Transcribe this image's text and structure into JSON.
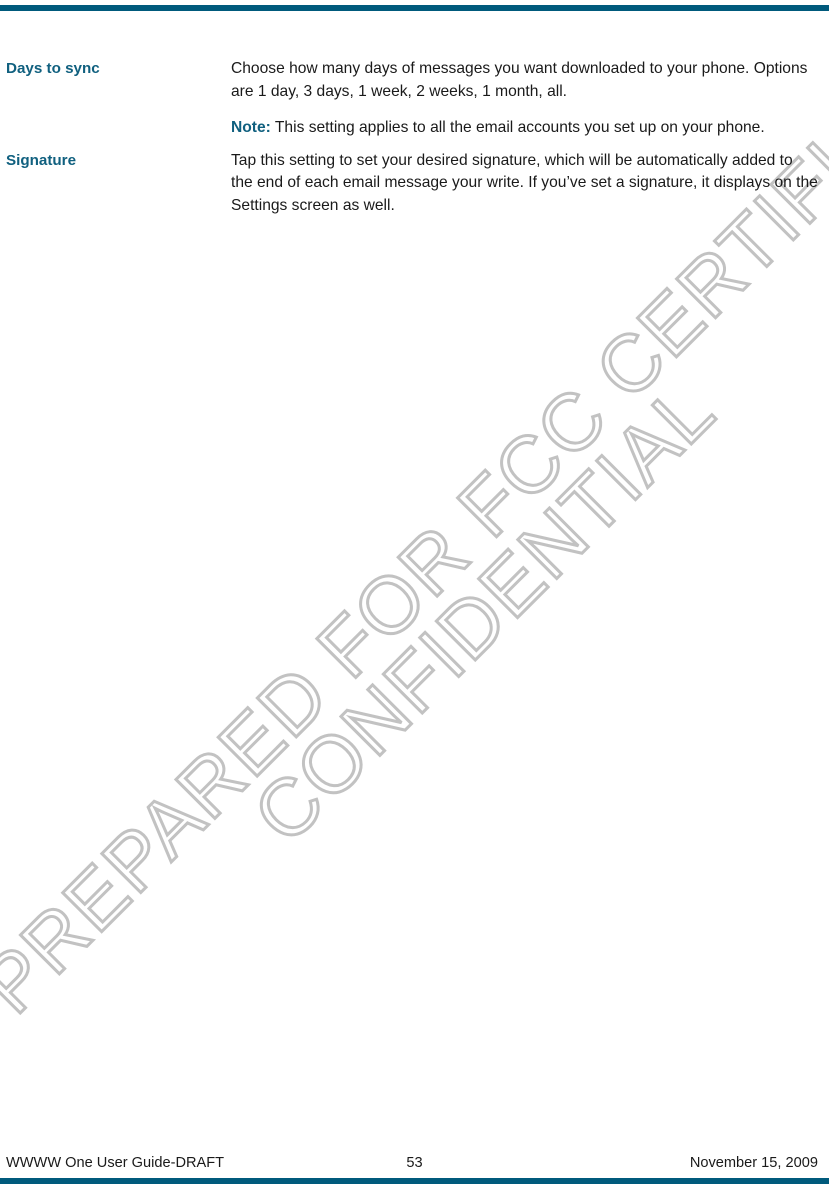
{
  "document": {
    "accent_color": "#005a7c",
    "heading_color": "#10607f",
    "body_color": "#1a1a1a",
    "watermark_color": "#c2c2c2"
  },
  "watermark": {
    "line1": "PREPARED FOR FCC CERTIFICATION",
    "line2": "CONFIDENTIAL"
  },
  "entries": [
    {
      "term": "Days to sync",
      "paragraphs": [
        {
          "label": "",
          "text": "Choose how many days of messages you want downloaded to your phone. Options are 1 day, 3 days, 1 week, 2 weeks, 1 month, all."
        },
        {
          "label": "Note:",
          "text": " This setting applies to all the email accounts you set up on your phone."
        }
      ]
    },
    {
      "term": "Signature",
      "paragraphs": [
        {
          "label": "",
          "text": "Tap this setting to set your desired signature, which will be automatically added to the end of each email message your write. If you’ve set a signature, it displays on the Settings screen as well."
        }
      ]
    }
  ],
  "footer": {
    "left": "WWWW One User Guide-DRAFT",
    "page_number": "53",
    "right": "November 15, 2009"
  }
}
